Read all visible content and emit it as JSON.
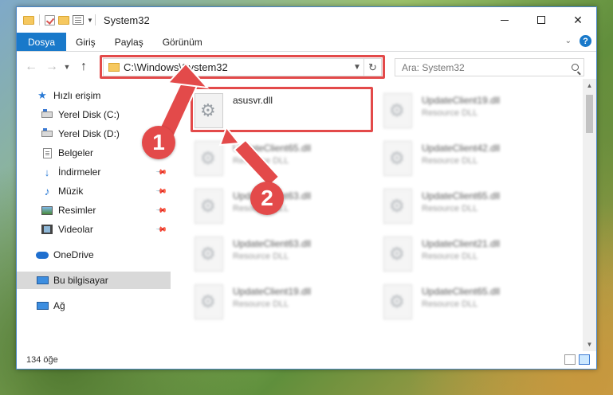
{
  "window": {
    "title": "System32"
  },
  "ribbon": {
    "tabs": [
      "Dosya",
      "Giriş",
      "Paylaş",
      "Görünüm"
    ],
    "help_label": "?"
  },
  "navbar": {
    "address": "C:\\Windows\\System32",
    "search_placeholder": "Ara: System32"
  },
  "sidebar": {
    "items": [
      {
        "label": "Hızlı erişim",
        "icon": "star-icon"
      },
      {
        "label": "Yerel Disk (C:)",
        "icon": "drive-icon"
      },
      {
        "label": "Yerel Disk (D:)",
        "icon": "drive-icon"
      },
      {
        "label": "Belgeler",
        "icon": "documents-icon"
      },
      {
        "label": "İndirmeler",
        "icon": "downloads-icon"
      },
      {
        "label": "Müzik",
        "icon": "music-icon"
      },
      {
        "label": "Resimler",
        "icon": "pictures-icon"
      },
      {
        "label": "Videolar",
        "icon": "videos-icon"
      },
      {
        "label": "OneDrive",
        "icon": "onedrive-icon"
      },
      {
        "label": "Bu bilgisayar",
        "icon": "computer-icon"
      },
      {
        "label": "Ağ",
        "icon": "network-icon"
      }
    ]
  },
  "files": {
    "highlighted": {
      "name": "asusvr.dll",
      "type": ""
    },
    "left_column": [
      {
        "name": "UpdateClient65.dll",
        "type": "Resource DLL"
      },
      {
        "name": "UpdateClient63.dll",
        "type": "Resource DLL"
      },
      {
        "name": "UpdateClient63.dll",
        "type": "Resource DLL"
      },
      {
        "name": "UpdateClient19.dll",
        "type": "Resource DLL"
      }
    ],
    "right_column": [
      {
        "name": "UpdateClient19.dll",
        "type": "Resource DLL"
      },
      {
        "name": "UpdateClient42.dll",
        "type": "Resource DLL"
      },
      {
        "name": "UpdateClient65.dll",
        "type": "Resource DLL"
      },
      {
        "name": "UpdateClient21.dll",
        "type": "Resource DLL"
      },
      {
        "name": "UpdateClient65.dll",
        "type": "Resource DLL"
      }
    ]
  },
  "status": {
    "count": "134 öğe"
  },
  "callouts": {
    "one": "1",
    "two": "2"
  },
  "colors": {
    "accent": "#1979ca",
    "highlight": "#e34a4a",
    "selected": "#cce8ff"
  }
}
